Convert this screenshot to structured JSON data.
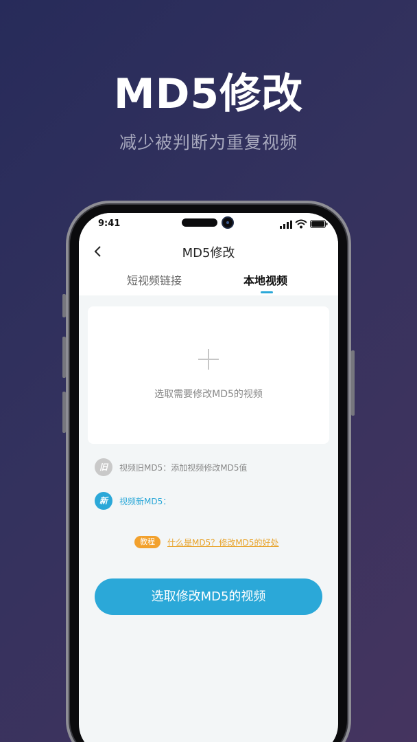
{
  "promo": {
    "title": "MD5修改",
    "subtitle": "减少被判断为重复视频"
  },
  "status_bar": {
    "time": "9:41",
    "icons": [
      "signal-icon",
      "wifi-icon",
      "battery-icon"
    ]
  },
  "nav": {
    "back_icon": "chevron-left-icon",
    "title": "MD5修改"
  },
  "tabs": [
    {
      "label": "短视频链接",
      "active": false
    },
    {
      "label": "本地视频",
      "active": true
    }
  ],
  "upload": {
    "icon": "plus-icon",
    "hint": "选取需要修改MD5的视频"
  },
  "md5": {
    "old_badge": "旧",
    "old_label": "视频旧MD5：添加视频修改MD5值",
    "new_badge": "新",
    "new_label": "视频新MD5："
  },
  "tutorial": {
    "tag": "教程",
    "link": "什么是MD5？修改MD5的好处"
  },
  "action": {
    "button_label": "选取修改MD5的视频"
  },
  "colors": {
    "accent": "#2ba8d8",
    "tutorial": "#f2a12d",
    "background_start": "#272b5a",
    "background_end": "#45345f"
  }
}
